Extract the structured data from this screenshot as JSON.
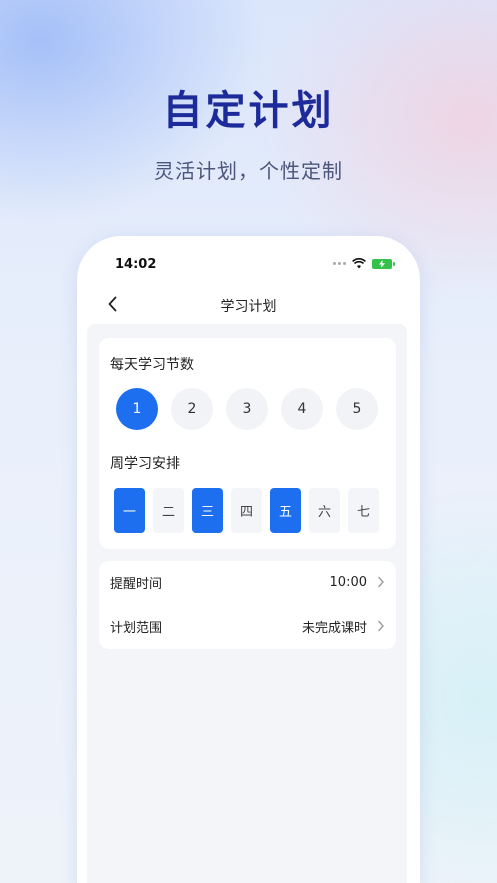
{
  "promo": {
    "headline": "自定计划",
    "subline": "灵活计划，个性定制"
  },
  "status_bar": {
    "time": "14:02"
  },
  "nav": {
    "title": "学习计划",
    "back_icon": "chevron-left-icon"
  },
  "lessons_per_day": {
    "title": "每天学习节数",
    "options": [
      "1",
      "2",
      "3",
      "4",
      "5"
    ],
    "selected": "1"
  },
  "weekly_schedule": {
    "title": "周学习安排",
    "days": [
      {
        "label": "一",
        "selected": true
      },
      {
        "label": "二",
        "selected": false
      },
      {
        "label": "三",
        "selected": true
      },
      {
        "label": "四",
        "selected": false
      },
      {
        "label": "五",
        "selected": true
      },
      {
        "label": "六",
        "selected": false
      },
      {
        "label": "七",
        "selected": false
      }
    ]
  },
  "settings": {
    "reminder_label": "提醒时间",
    "reminder_value": "10:00",
    "scope_label": "计划范围",
    "scope_value": "未完成课时"
  },
  "colors": {
    "accent": "#1d6ff0",
    "headline": "#1d2a9a",
    "battery": "#35c24b"
  }
}
